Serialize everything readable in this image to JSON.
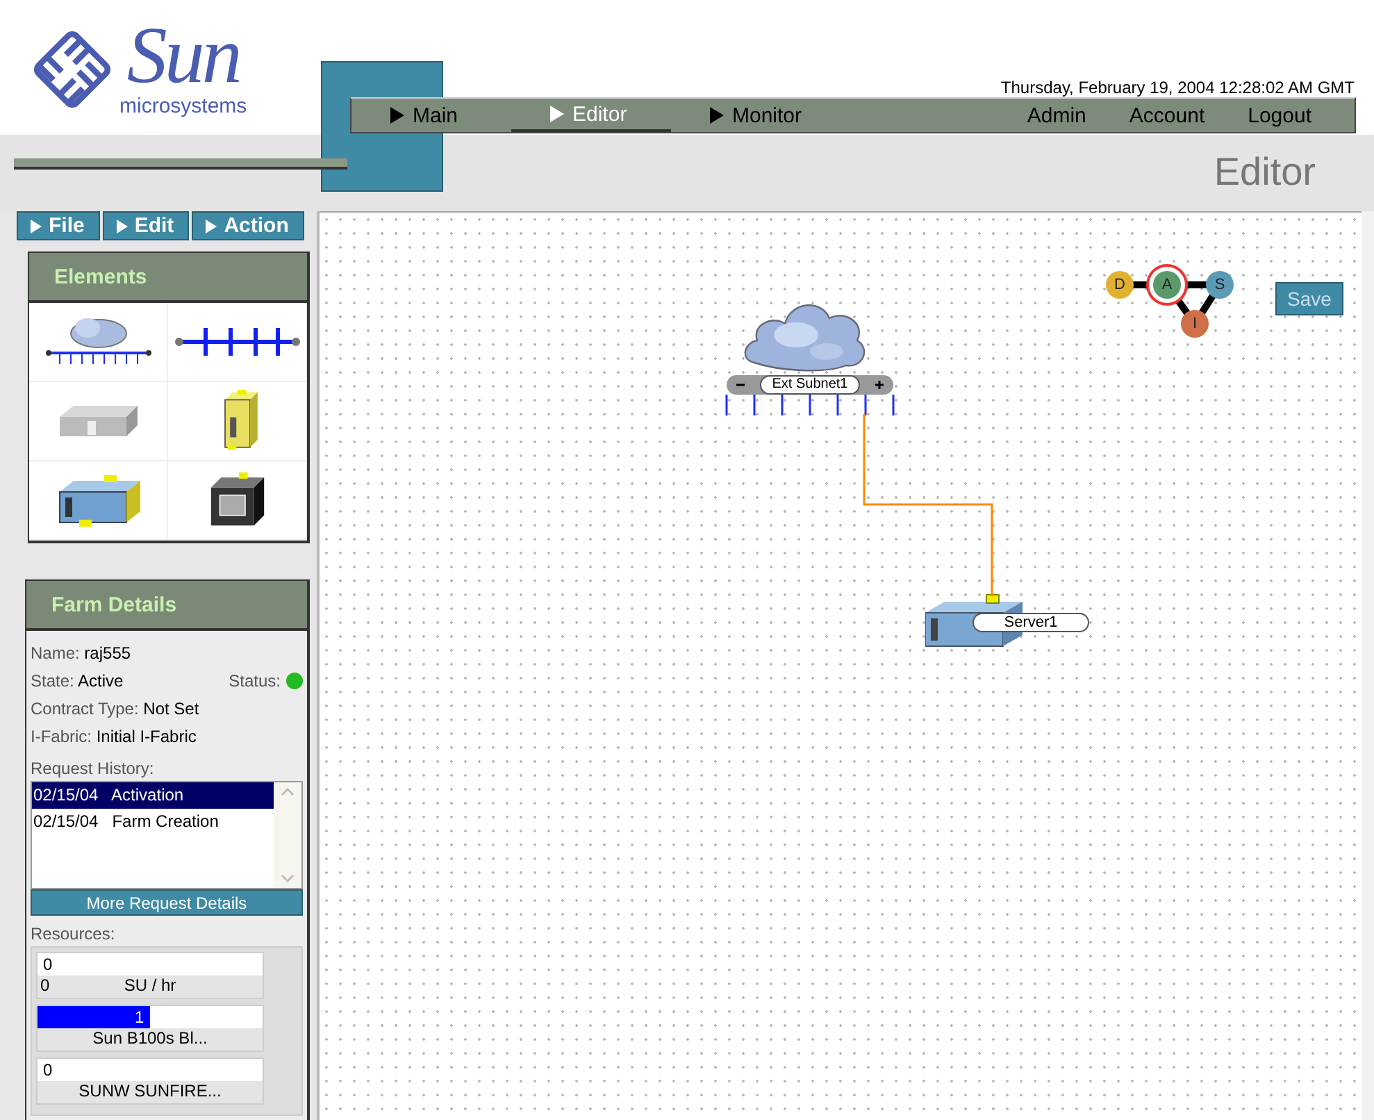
{
  "logo": {
    "brand": "Sun",
    "tagline": "microsystems"
  },
  "datetime": "Thursday, February 19, 2004 12:28:02 AM GMT",
  "nav": {
    "tabs": [
      {
        "label": "Main",
        "selected": false
      },
      {
        "label": "Editor",
        "selected": true
      },
      {
        "label": "Monitor",
        "selected": false
      }
    ],
    "links": [
      "Admin",
      "Account",
      "Logout"
    ]
  },
  "page_title": "Editor",
  "menus": [
    "File",
    "Edit",
    "Action"
  ],
  "elements_palette": {
    "title": "Elements",
    "items": [
      {
        "kind": "subnet"
      },
      {
        "kind": "vlan"
      },
      {
        "kind": "loadbalancer"
      },
      {
        "kind": "tower"
      },
      {
        "kind": "server"
      },
      {
        "kind": "firewall"
      }
    ]
  },
  "farm_details": {
    "title": "Farm Details",
    "fields": [
      {
        "label": "Name:",
        "value": "raj555"
      },
      {
        "label": "State:",
        "value": "Active"
      },
      {
        "label": "Contract Type:",
        "value": "Not Set"
      },
      {
        "label": "I-Fabric:",
        "value": "Initial I-Fabric"
      }
    ],
    "status": {
      "label": "Status:",
      "color": "#22bb22"
    },
    "request_history": {
      "title": "Request History:",
      "rows": [
        {
          "date": "02/15/04",
          "event": "Activation",
          "selected": true
        },
        {
          "date": "02/15/04",
          "event": "Farm Creation",
          "selected": false
        }
      ],
      "button": "More Request Details"
    },
    "resources": {
      "title": "Resources:",
      "items": [
        {
          "value": "0",
          "level": 0,
          "amount": "0",
          "label": "SU / hr"
        },
        {
          "value": "1",
          "level": 0.5,
          "label": "Sun B100s Bl..."
        },
        {
          "value": "0",
          "level": 0,
          "label": "SUNW SUNFIRE..."
        }
      ]
    }
  },
  "canvas": {
    "nodes": [
      {
        "kind": "subnet",
        "label": "Ext Subnet1"
      },
      {
        "kind": "server",
        "label": "Server1"
      }
    ],
    "workflow": [
      {
        "letter": "D",
        "color": "#e0b030",
        "selected": false
      },
      {
        "letter": "A",
        "color": "#5a9a6a",
        "selected": true
      },
      {
        "letter": "S",
        "color": "#5b9ab5",
        "selected": false
      },
      {
        "letter": "I",
        "color": "#d07048",
        "selected": false
      }
    ],
    "save_button": "Save"
  }
}
